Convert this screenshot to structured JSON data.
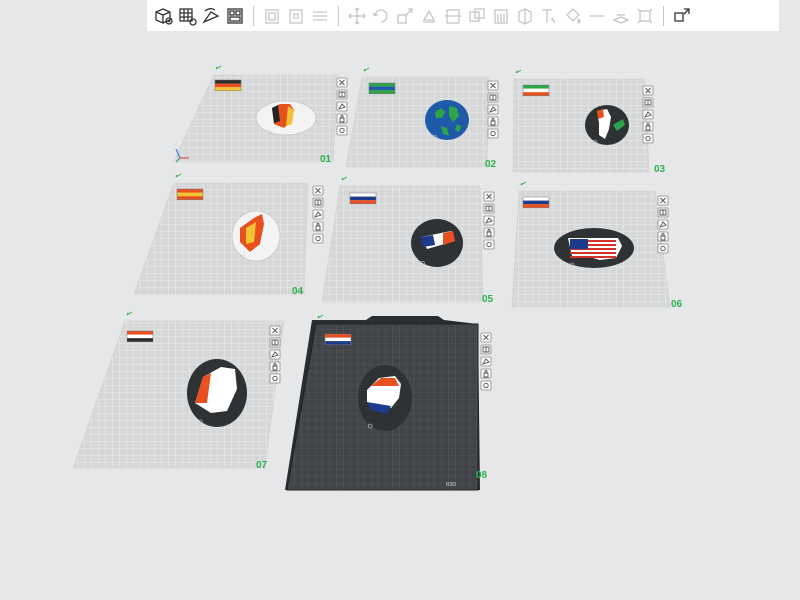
{
  "toolbar": {
    "tools": [
      {
        "name": "add-object-icon",
        "active": true
      },
      {
        "name": "add-plate-icon",
        "active": true
      },
      {
        "name": "auto-orient-icon",
        "active": true
      },
      {
        "name": "arrange-icon",
        "active": true
      },
      {
        "name": "split-objects-icon",
        "active": false
      },
      {
        "name": "split-parts-icon",
        "active": false
      },
      {
        "name": "layers-icon",
        "active": false
      },
      {
        "name": "move-icon",
        "active": false
      },
      {
        "name": "rotate-icon",
        "active": false
      },
      {
        "name": "scale-icon",
        "active": false
      },
      {
        "name": "lay-on-face-icon",
        "active": false
      },
      {
        "name": "cut-icon",
        "active": false
      },
      {
        "name": "boolean-icon",
        "active": false
      },
      {
        "name": "support-paint-icon",
        "active": false
      },
      {
        "name": "seam-paint-icon",
        "active": false
      },
      {
        "name": "text-icon",
        "active": false
      },
      {
        "name": "color-paint-icon",
        "active": false
      },
      {
        "name": "measure-icon",
        "active": false
      },
      {
        "name": "assembly-icon",
        "active": false
      },
      {
        "name": "fit-view-icon",
        "active": false
      },
      {
        "name": "explode-view-icon",
        "active": true
      }
    ]
  },
  "plates": [
    {
      "label": "01",
      "object": "flag-map-germany-belgium-style",
      "selected": false
    },
    {
      "label": "02",
      "object": "flag-map-green-blue-world",
      "selected": false
    },
    {
      "label": "03",
      "object": "flag-map-black-green-white",
      "selected": false
    },
    {
      "label": "04",
      "object": "flag-map-spain-style",
      "selected": false
    },
    {
      "label": "05",
      "object": "flag-map-tricolor-blue-white-red",
      "selected": false
    },
    {
      "label": "06",
      "object": "flag-map-usa",
      "selected": false
    },
    {
      "label": "07",
      "object": "flag-map-orange-white",
      "selected": false
    },
    {
      "label": "08",
      "object": "flag-map-netherlands",
      "selected": true
    }
  ],
  "plate_brand_text": "R3D"
}
